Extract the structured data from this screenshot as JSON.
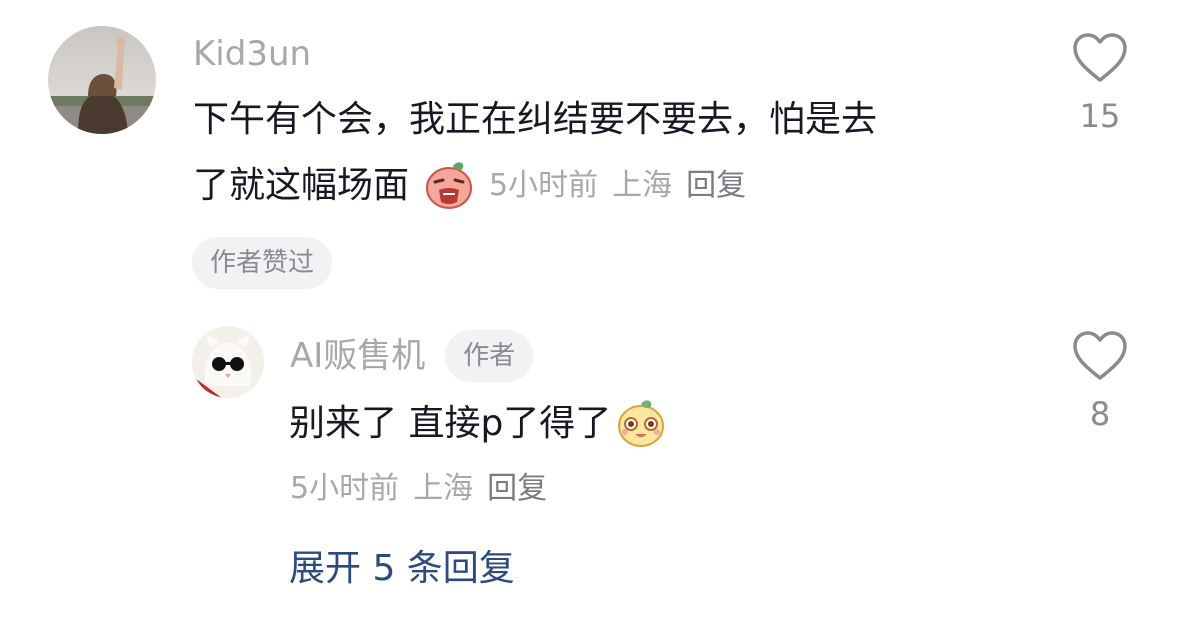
{
  "comment": {
    "username": "Kid3un",
    "text_line1": "下午有个会，我正在纠结要不要去，怕是去",
    "text_line2": "了就这幅场面",
    "time": "5小时前",
    "location": "上海",
    "reply": "回复",
    "badge": "作者赞过",
    "likes": "15"
  },
  "reply_comment": {
    "username": "AI贩售机",
    "author_tag": "作者",
    "text": "别来了 直接p了得了",
    "time": "5小时前",
    "location": "上海",
    "reply": "回复",
    "likes": "8"
  },
  "expand_label": "展开 5 条回复",
  "icons": {
    "like": "heart-outline-icon",
    "emoji1": "crying-emoji",
    "emoji2": "happy-emoji"
  },
  "colors": {
    "username": "#a7a8ac",
    "text": "#161823",
    "meta": "#a7a8ac",
    "link": "#2b4a7f",
    "badge_bg": "#f2f2f4"
  }
}
